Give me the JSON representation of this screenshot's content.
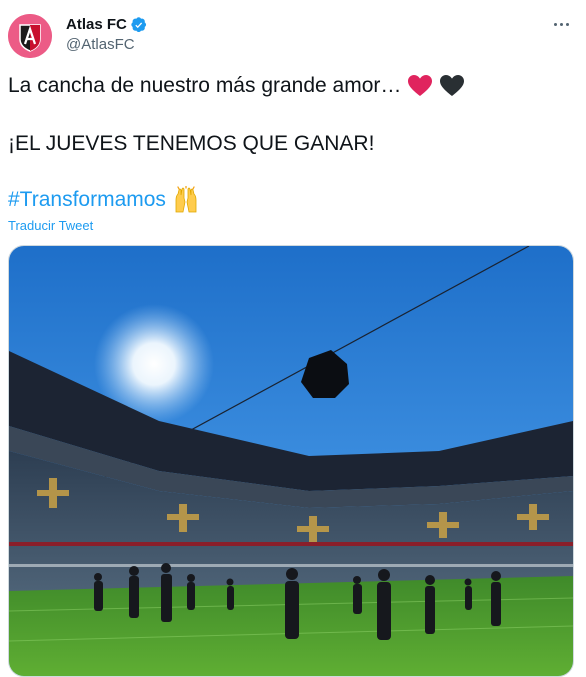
{
  "account": {
    "name": "Atlas FC",
    "handle": "@AtlasFC",
    "avatar_icon": "atlas-crest-icon",
    "verified_icon": "verified-badge-icon"
  },
  "tweet": {
    "line1": "La cancha de nuestro más grande amor…",
    "line1_emojis": [
      "red-heart-icon",
      "black-heart-icon"
    ],
    "line2": "¡EL JUEVES TENEMOS QUE GANAR!",
    "hashtag": "#Transformamos",
    "line3_emoji": "raising-hands-icon",
    "translate_label": "Traducir Tweet"
  },
  "media": {
    "description_icon": "stadium-photo"
  },
  "colors": {
    "accent": "#1d9bf0",
    "avatar_bg": "#ec5b86",
    "heart_red": "#e0245e",
    "heart_black": "#292f33"
  }
}
